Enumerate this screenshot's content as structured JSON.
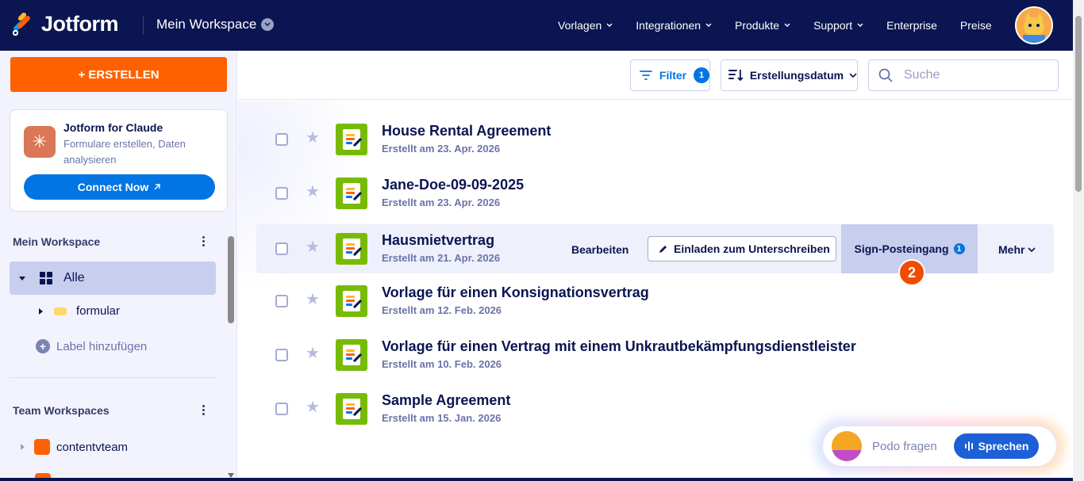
{
  "header": {
    "logo_text": "Jotform",
    "workspace": "Mein Workspace",
    "nav": [
      "Vorlagen",
      "Integrationen",
      "Produkte",
      "Support",
      "Enterprise",
      "Preise"
    ]
  },
  "sidebar": {
    "create_label": "+ ERSTELLEN",
    "promo": {
      "title": "Jotform for Claude",
      "description": "Formulare erstellen, Daten analysieren",
      "button": "Connect Now"
    },
    "my_workspace_title": "Mein Workspace",
    "all_label": "Alle",
    "folder_label": "formular",
    "add_label": "Label hinzufügen",
    "team_title": "Team Workspaces",
    "team_item": "contentvteam"
  },
  "toolbar": {
    "filter_label": "Filter",
    "filter_count": "1",
    "sort_label": "Erstellungsdatum",
    "search_placeholder": "Suche"
  },
  "forms": [
    {
      "title": "House Rental Agreement",
      "created": "Erstellt am 23. Apr. 2026"
    },
    {
      "title": "Jane-Doe-09-09-2025",
      "created": "Erstellt am 23. Apr. 2026"
    },
    {
      "title": "Hausmietvertrag",
      "created": "Erstellt am 21. Apr. 2026"
    },
    {
      "title": "Vorlage für einen Konsignationsvertrag",
      "created": "Erstellt am 12. Feb. 2026"
    },
    {
      "title": "Vorlage für einen Vertrag mit einem Unkrautbekämpfungsdienstleister",
      "created": "Erstellt am 10. Feb. 2026"
    },
    {
      "title": "Sample Agreement",
      "created": "Erstellt am 15. Jan. 2026"
    }
  ],
  "row_actions": {
    "edit": "Bearbeiten",
    "invite": "Einladen zum Unterschreiben",
    "inbox": "Sign-Posteingang",
    "inbox_count": "1",
    "more": "Mehr",
    "step_badge": "2"
  },
  "podo": {
    "placeholder": "Podo fragen",
    "speak": "Sprechen"
  }
}
